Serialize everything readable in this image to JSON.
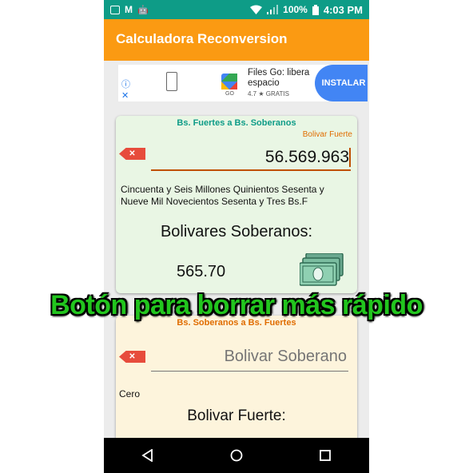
{
  "status_bar": {
    "battery": "100%",
    "time": "4:03 PM",
    "icons": [
      "image-icon",
      "gmail-icon",
      "android-icon",
      "wifi-icon",
      "signal-icon",
      "battery-icon"
    ]
  },
  "app_bar": {
    "title": "Calculadora Reconversion"
  },
  "ad": {
    "title": "Files Go: libera espacio",
    "brand": "GO",
    "rating": "4.7 ★ GRATIS",
    "install_label": "INSTALAR"
  },
  "card_fuertes": {
    "title": "Bs. Fuertes a Bs. Soberanos",
    "unit_label": "Bolivar Fuerte",
    "clear_label": "✕",
    "input_value": "56.569.963",
    "words": "Cincuenta y Seis Millones Quinientos Sesenta y Nueve Mil Novecientos Sesenta y Tres  Bs.F",
    "result_label": "Bolivares Soberanos:",
    "result_value": "565.70"
  },
  "overlay_caption": "Botón para borrar más rápido",
  "card_soberanos": {
    "title": "Bs. Soberanos a Bs. Fuertes",
    "clear_label": "✕",
    "input_placeholder": "Bolivar Soberano",
    "words": "Cero",
    "result_label": "Bolivar Fuerte:"
  },
  "colors": {
    "status_bar": "#0e9c87",
    "app_bar": "#fb9a12",
    "card_fuertes_bg": "#e9f6e4",
    "card_soberanos_bg": "#fdf4dc",
    "clear_button": "#e74c3c",
    "overlay_text": "#22c51e"
  }
}
